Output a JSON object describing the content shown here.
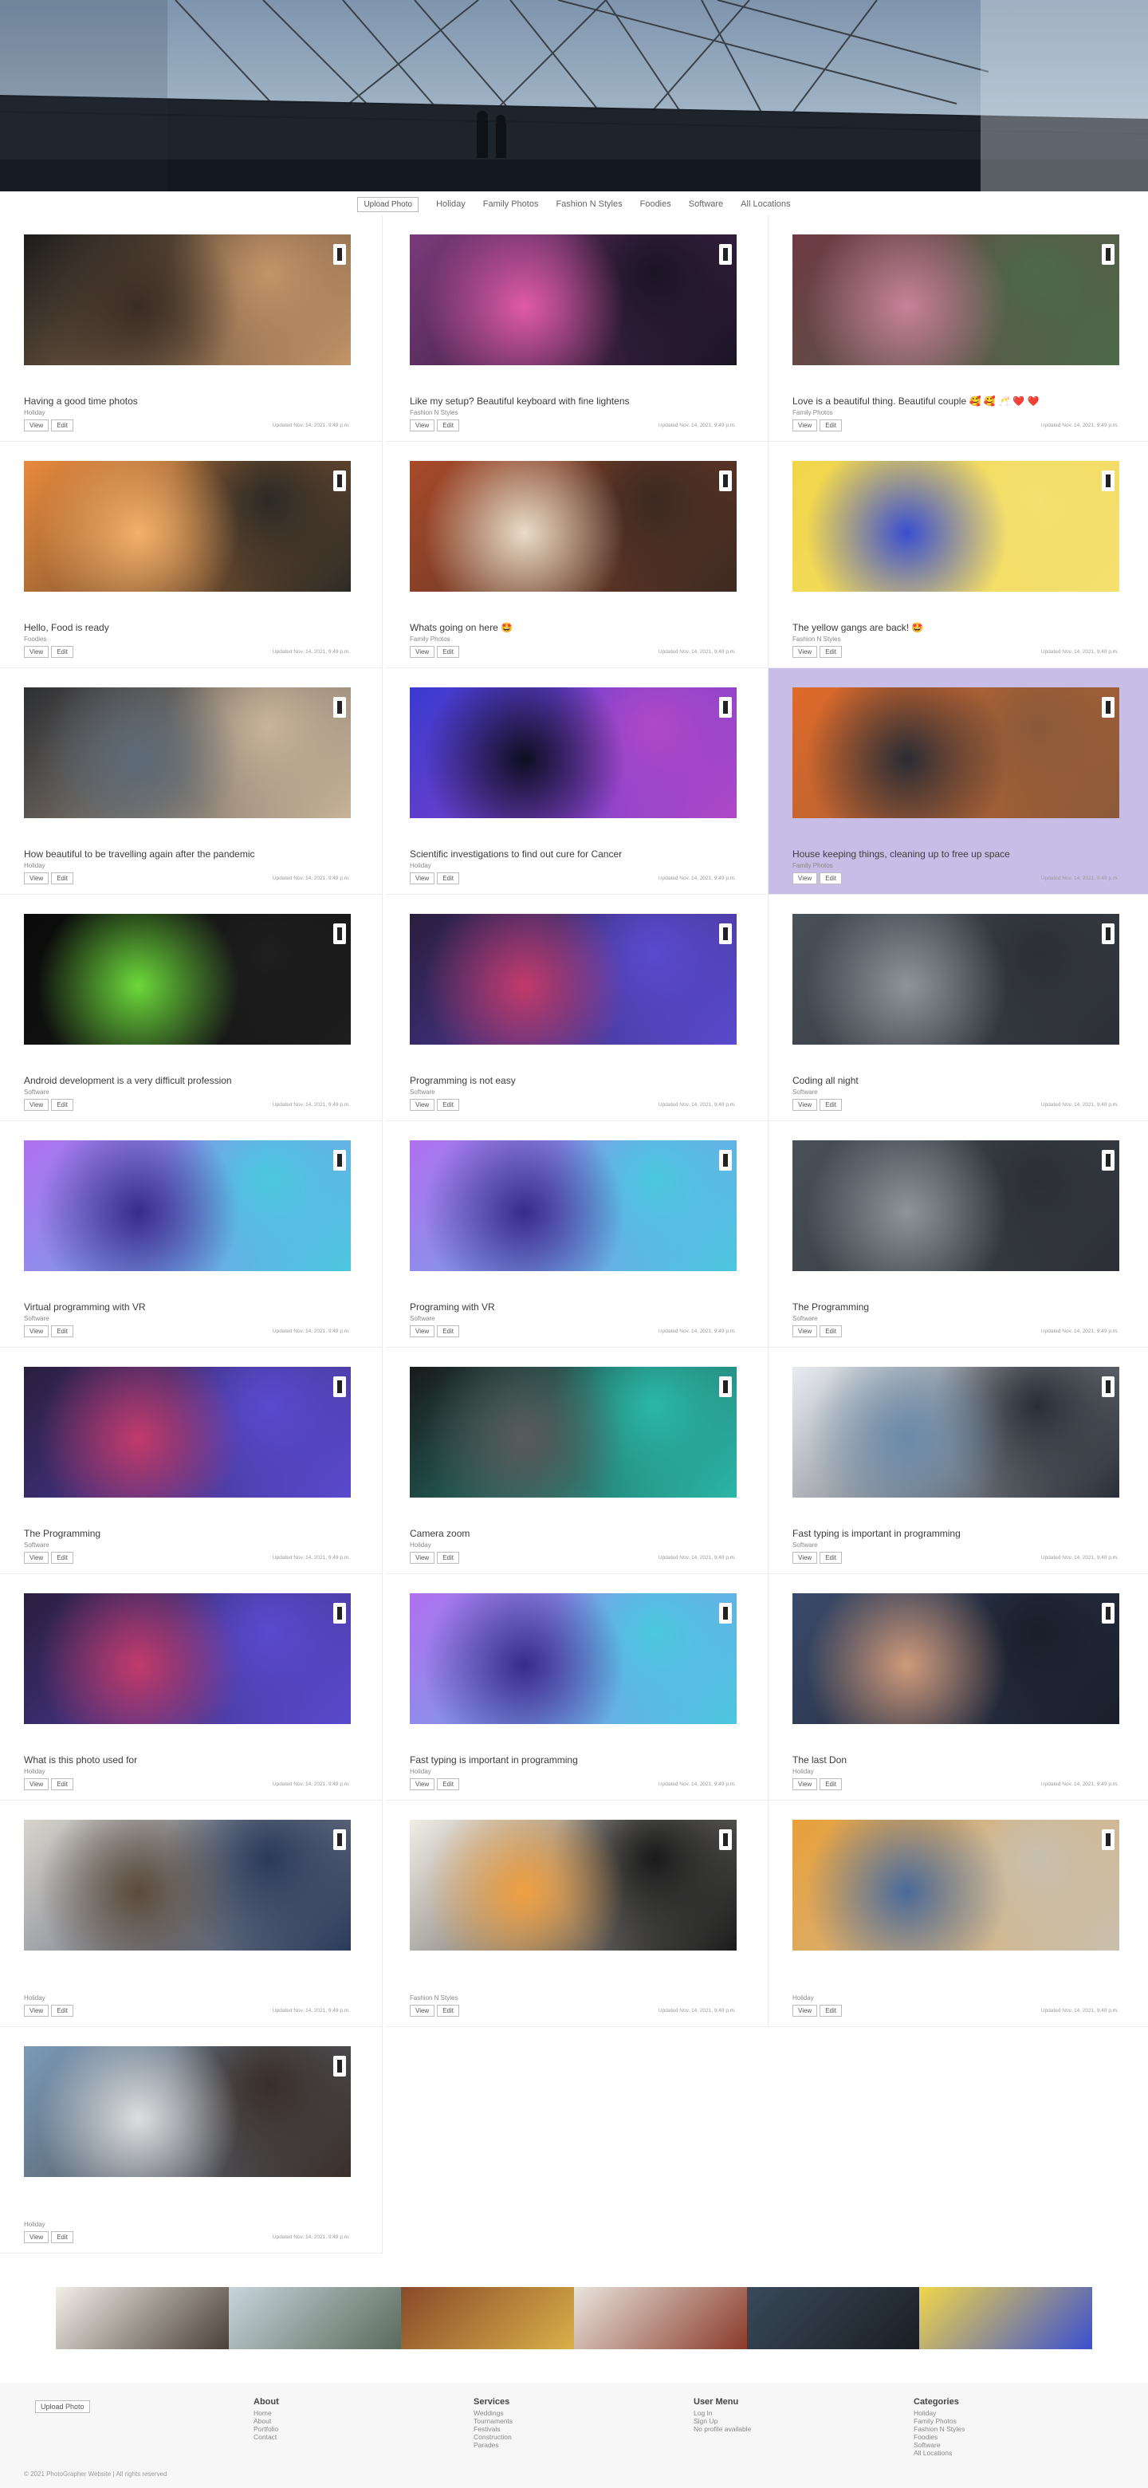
{
  "nav": {
    "upload_label": "Upload Photo",
    "categories": [
      "Holiday",
      "Family Photos",
      "Fashion N Styles",
      "Foodies",
      "Software",
      "All Locations"
    ]
  },
  "actions": {
    "view": "View",
    "edit": "Edit"
  },
  "cards": [
    {
      "title": "Having a good time photos",
      "category": "Holiday",
      "updated": "Updated Nov. 14, 2021, 9:49 p.m.",
      "palette": [
        "#1c1c1c",
        "#3a2d24",
        "#c49468"
      ],
      "highlight": false
    },
    {
      "title": "Like my setup? Beautiful keyboard with fine lightens",
      "category": "Fashion N Styles",
      "updated": "Updated Nov. 14, 2021, 9:49 p.m.",
      "palette": [
        "#7a3a7a",
        "#e05aa8",
        "#1a1424"
      ],
      "highlight": false
    },
    {
      "title": "Love is a beautiful thing. Beautiful couple 🥰 🥰 🥂 ❤️ ❤️",
      "category": "Family Photos",
      "updated": "Updated Nov. 14, 2021, 9:49 p.m.",
      "palette": [
        "#6e3a44",
        "#c8829a",
        "#4d6a4a"
      ],
      "highlight": false
    },
    {
      "title": "Hello, Food is ready",
      "category": "Foodies",
      "updated": "Updated Nov. 14, 2021, 9:49 p.m.",
      "palette": [
        "#e88a3c",
        "#f2b06a",
        "#2c2a26"
      ],
      "highlight": false
    },
    {
      "title": "Whats going on here 🤩",
      "category": "Family Photos",
      "updated": "Updated Nov. 14, 2021, 9:49 p.m.",
      "palette": [
        "#a84a2a",
        "#e8ddc8",
        "#3c2a22"
      ],
      "highlight": false
    },
    {
      "title": "The yellow gangs are back! 🤩",
      "category": "Fashion N Styles",
      "updated": "Updated Nov. 14, 2021, 9:49 p.m.",
      "palette": [
        "#f1d64a",
        "#3a4fd0",
        "#f5e070"
      ],
      "highlight": false
    },
    {
      "title": "How beautiful to be travelling again after the pandemic",
      "category": "Holiday",
      "updated": "Updated Nov. 14, 2021, 9:49 p.m.",
      "palette": [
        "#2d2f33",
        "#5c6a78",
        "#c9b49a"
      ],
      "highlight": false
    },
    {
      "title": "Scientific investigations to find out cure for Cancer",
      "category": "Holiday",
      "updated": "Updated Nov. 14, 2021, 9:49 p.m.",
      "palette": [
        "#3a3ad0",
        "#0e0e22",
        "#b048c8"
      ],
      "highlight": false
    },
    {
      "title": "House keeping things, cleaning up to free up space",
      "category": "Family Photos",
      "updated": "Updated Nov. 14, 2021, 9:49 p.m.",
      "palette": [
        "#e06a2a",
        "#2a2c34",
        "#8a5a3a"
      ],
      "highlight": true
    },
    {
      "title": "Android development is a very difficult profession",
      "category": "Software",
      "updated": "Updated Nov. 14, 2021, 9:49 p.m.",
      "palette": [
        "#0a0a0a",
        "#6cd93a",
        "#1e1e1e"
      ],
      "highlight": false
    },
    {
      "title": "Programming is not easy",
      "category": "Software",
      "updated": "Updated Nov. 14, 2021, 9:49 p.m.",
      "palette": [
        "#2a1e3e",
        "#c23a6a",
        "#5a4ad0"
      ],
      "highlight": false
    },
    {
      "title": "Coding all night",
      "category": "Software",
      "updated": "Updated Nov. 14, 2021, 9:49 p.m.",
      "palette": [
        "#4a5058",
        "#8e949a",
        "#2c3036"
      ],
      "highlight": false
    },
    {
      "title": "Virtual programming with VR",
      "category": "Software",
      "updated": "Updated Nov. 14, 2021, 9:49 p.m.",
      "palette": [
        "#b070f0",
        "#3a2a8a",
        "#4ac8e0"
      ],
      "highlight": false
    },
    {
      "title": "Programing with VR",
      "category": "Software",
      "updated": "Updated Nov. 14, 2021, 9:49 p.m.",
      "palette": [
        "#b070f0",
        "#3a2a8a",
        "#4ac8e0"
      ],
      "highlight": false
    },
    {
      "title": "The Programming",
      "category": "Software",
      "updated": "Updated Nov. 14, 2021, 9:49 p.m.",
      "palette": [
        "#4a5058",
        "#8e949a",
        "#2c3036"
      ],
      "highlight": false
    },
    {
      "title": "The Programming",
      "category": "Software",
      "updated": "Updated Nov. 14, 2021, 9:49 p.m.",
      "palette": [
        "#2a1e3e",
        "#c23a6a",
        "#5a4ad0"
      ],
      "highlight": false
    },
    {
      "title": "Camera zoom",
      "category": "Holiday",
      "updated": "Updated Nov. 14, 2021, 9:49 p.m.",
      "palette": [
        "#1a1a1a",
        "#5a5a5a",
        "#2ab8a8"
      ],
      "highlight": false
    },
    {
      "title": "Fast typing is important in programming",
      "category": "Software",
      "updated": "Updated Nov. 14, 2021, 9:49 p.m.",
      "palette": [
        "#e8ecf0",
        "#6a8aaa",
        "#2a2e36"
      ],
      "highlight": false
    },
    {
      "title": "What is this photo used for",
      "category": "Holiday",
      "updated": "Updated Nov. 14, 2021, 9:49 p.m.",
      "palette": [
        "#2a1e3e",
        "#c23a6a",
        "#5a4ad0"
      ],
      "highlight": false
    },
    {
      "title": "Fast typing is important in programming",
      "category": "Holiday",
      "updated": "Updated Nov. 14, 2021, 9:49 p.m.",
      "palette": [
        "#b070f0",
        "#3a2a8a",
        "#4ac8e0"
      ],
      "highlight": false
    },
    {
      "title": "The last Don",
      "category": "Holiday",
      "updated": "Updated Nov. 14, 2021, 9:49 p.m.",
      "palette": [
        "#3a4a6a",
        "#d09a7a",
        "#1a1e2a"
      ],
      "highlight": false
    },
    {
      "title": "",
      "category": "Holiday",
      "updated": "Updated Nov. 14, 2021, 9:49 p.m.",
      "palette": [
        "#d8d4cc",
        "#5a4a3a",
        "#2a3a5a"
      ],
      "highlight": false
    },
    {
      "title": "",
      "category": "Fashion N Styles",
      "updated": "Updated Nov. 14, 2021, 9:49 p.m.",
      "palette": [
        "#f0ece6",
        "#f0a040",
        "#1a1a1a"
      ],
      "highlight": false
    },
    {
      "title": "",
      "category": "Holiday",
      "updated": "Updated Nov. 14, 2021, 9:49 p.m.",
      "palette": [
        "#e8a03a",
        "#4a6a9a",
        "#c8c0b0"
      ],
      "highlight": false
    },
    {
      "title": "",
      "category": "Holiday",
      "updated": "Updated Nov. 14, 2021, 9:49 p.m.",
      "palette": [
        "#7a9ab8",
        "#dedede",
        "#3a2e28"
      ],
      "highlight": false
    }
  ],
  "strip": [
    {
      "name": "strip-photo-1",
      "colors": [
        "#f2efe8",
        "#4a4038"
      ]
    },
    {
      "name": "strip-photo-2",
      "colors": [
        "#c8d4dc",
        "#5a6a5a"
      ]
    },
    {
      "name": "strip-photo-3",
      "colors": [
        "#8a4a2a",
        "#d8b048"
      ]
    },
    {
      "name": "strip-photo-4",
      "colors": [
        "#e8e4dc",
        "#8a3a2a"
      ]
    },
    {
      "name": "strip-photo-5",
      "colors": [
        "#3a4a5a",
        "#1a1e24"
      ]
    },
    {
      "name": "strip-photo-6",
      "colors": [
        "#f1d64a",
        "#3a4fd0"
      ]
    }
  ],
  "footer": {
    "upload_label": "Upload Photo",
    "columns": [
      {
        "heading": "About",
        "items": [
          "Home",
          "About",
          "Portfolio",
          "Contact"
        ]
      },
      {
        "heading": "Services",
        "items": [
          "Weddings",
          "Tournaments",
          "Festivals",
          "Construction",
          "Parades"
        ]
      },
      {
        "heading": "User Menu",
        "items": [
          "Log In",
          "Sign Up",
          "No profile available"
        ]
      },
      {
        "heading": "Categories",
        "items": [
          "Holiday",
          "Family Photos",
          "Fashion N Styles",
          "Foodies",
          "Software",
          "All Locations"
        ]
      }
    ],
    "copyright": "© 2021 PhotoGrapher Website | All rights reserved"
  },
  "colors": {
    "highlight": "#c8bde6",
    "border": "#ececec",
    "footer_bg": "#f7f7f7"
  }
}
